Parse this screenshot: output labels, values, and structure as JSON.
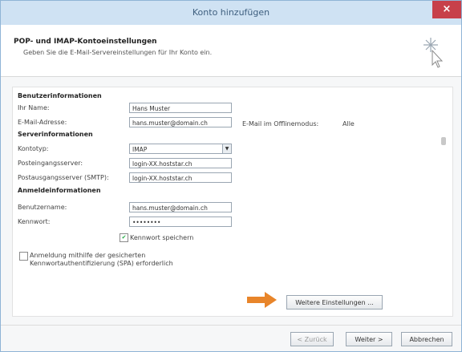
{
  "window": {
    "title": "Konto hinzufügen",
    "close_symbol": "×"
  },
  "header": {
    "title": "POP- und IMAP-Kontoeinstellungen",
    "subtitle": "Geben Sie die E-Mail-Servereinstellungen für Ihr Konto ein."
  },
  "user_info": {
    "section": "Benutzerinformationen",
    "name_label": "Ihr Name:",
    "name_value": "Hans Muster",
    "email_label": "E-Mail-Adresse:",
    "email_value": "hans.muster@domain.ch"
  },
  "offline": {
    "label": "E-Mail im Offlinemodus:",
    "value": "Alle"
  },
  "server_info": {
    "section": "Serverinformationen",
    "type_label": "Kontotyp:",
    "type_value": "IMAP",
    "incoming_label": "Posteingangsserver:",
    "incoming_value": "login-XX.hoststar.ch",
    "outgoing_label": "Postausgangsserver (SMTP):",
    "outgoing_value": "login-XX.hoststar.ch"
  },
  "login_info": {
    "section": "Anmeldeinformationen",
    "username_label": "Benutzername:",
    "username_value": "hans.muster@domain.ch",
    "password_label": "Kennwort:",
    "password_value": "••••••••",
    "remember_label": "Kennwort speichern",
    "spa_label_line1": "Anmeldung mithilfe der gesicherten",
    "spa_label_line2": "Kennwortauthentifizierung (SPA) erforderlich"
  },
  "more_settings_label": "Weitere Einstellungen ...",
  "footer": {
    "back_label": "< Zurück",
    "next_label": "Weiter >",
    "cancel_label": "Abbrechen"
  },
  "colors": {
    "arrow": "#e8852a",
    "titlebar": "#cfe2f3",
    "close": "#c7404a"
  }
}
